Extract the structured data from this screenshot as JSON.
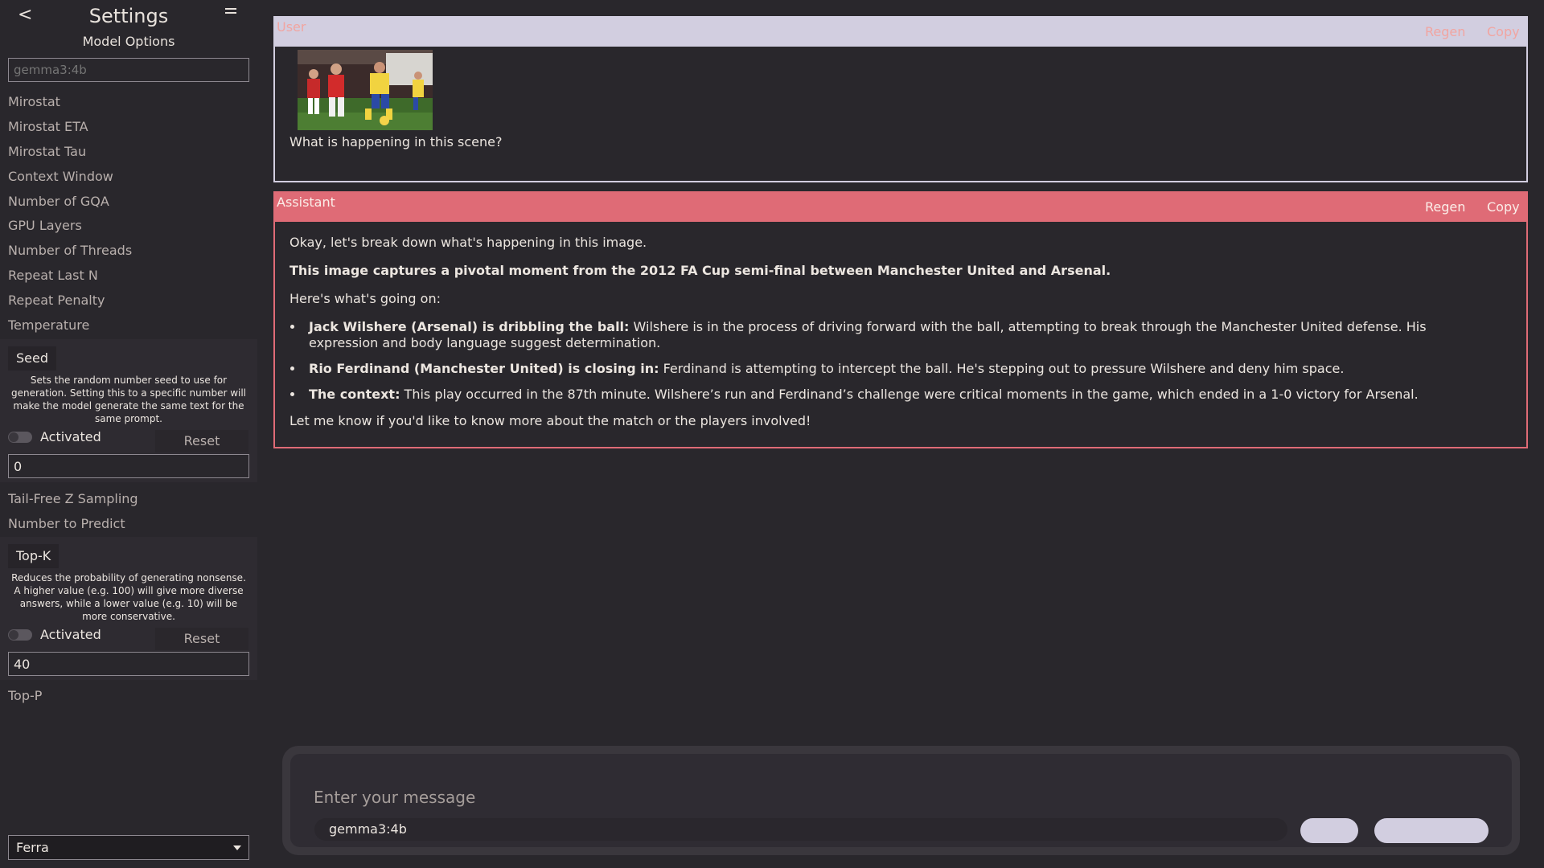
{
  "sidebar": {
    "back_label": "<",
    "title": "Settings",
    "subtitle": "Model Options",
    "model_placeholder": "gemma3:4b",
    "options_top": [
      "Mirostat",
      "Mirostat ETA",
      "Mirostat Tau",
      "Context Window",
      "Number of GQA",
      "GPU Layers",
      "Number of Threads",
      "Repeat Last N",
      "Repeat Penalty",
      "Temperature"
    ],
    "seed": {
      "label": "Seed",
      "description": "Sets the random number seed to use for generation. Setting this to a specific number will make the model generate the same text for the same prompt.",
      "activated_label": "Activated",
      "activated": false,
      "reset_label": "Reset",
      "value": "0"
    },
    "options_mid": [
      "Tail-Free Z Sampling",
      "Number to Predict"
    ],
    "topk": {
      "label": "Top-K",
      "description": "Reduces the probability of generating nonsense. A higher value (e.g. 100) will give more diverse answers, while a lower value (e.g. 10) will be more conservative.",
      "activated_label": "Activated",
      "activated": false,
      "reset_label": "Reset",
      "value": "40"
    },
    "options_bottom": [
      "Top-P"
    ],
    "theme_select": "Ferra"
  },
  "messages": {
    "user": {
      "role": "User",
      "regen_label": "Regen",
      "copy_label": "Copy",
      "text": "What is happening in this scene?"
    },
    "assistant": {
      "role": "Assistant",
      "regen_label": "Regen",
      "copy_label": "Copy",
      "intro": "Okay, let's break down what's happening in this image.",
      "headline": "This image captures a pivotal moment from the 2012 FA Cup semi-final between Manchester United and Arsenal.",
      "lead": "Here's what's going on:",
      "bullets": [
        {
          "bold": "Jack Wilshere (Arsenal) is dribbling the ball:",
          "text": " Wilshere is in the process of driving forward with the ball, attempting to break through the Manchester United defense. His expression and body language suggest determination."
        },
        {
          "bold": "Rio Ferdinand (Manchester United) is closing in:",
          "text": " Ferdinand is attempting to intercept the ball. He's stepping out to pressure Wilshere and deny him space."
        },
        {
          "bold": "The context:",
          "text": " This play occurred in the 87th minute. Wilshere’s run and Ferdinand’s challenge were critical moments in the game, which ended in a 1-0 victory for Arsenal."
        }
      ],
      "outro": "Let me know if you'd like to know more about the match or the players involved!"
    }
  },
  "composer": {
    "placeholder": "Enter your message",
    "model_chip": "gemma3:4b"
  },
  "colors": {
    "background": "#29272c",
    "user_accent": "#d2cee0",
    "assistant_accent": "#df6b76",
    "text_salmon": "#f1a5a1"
  }
}
